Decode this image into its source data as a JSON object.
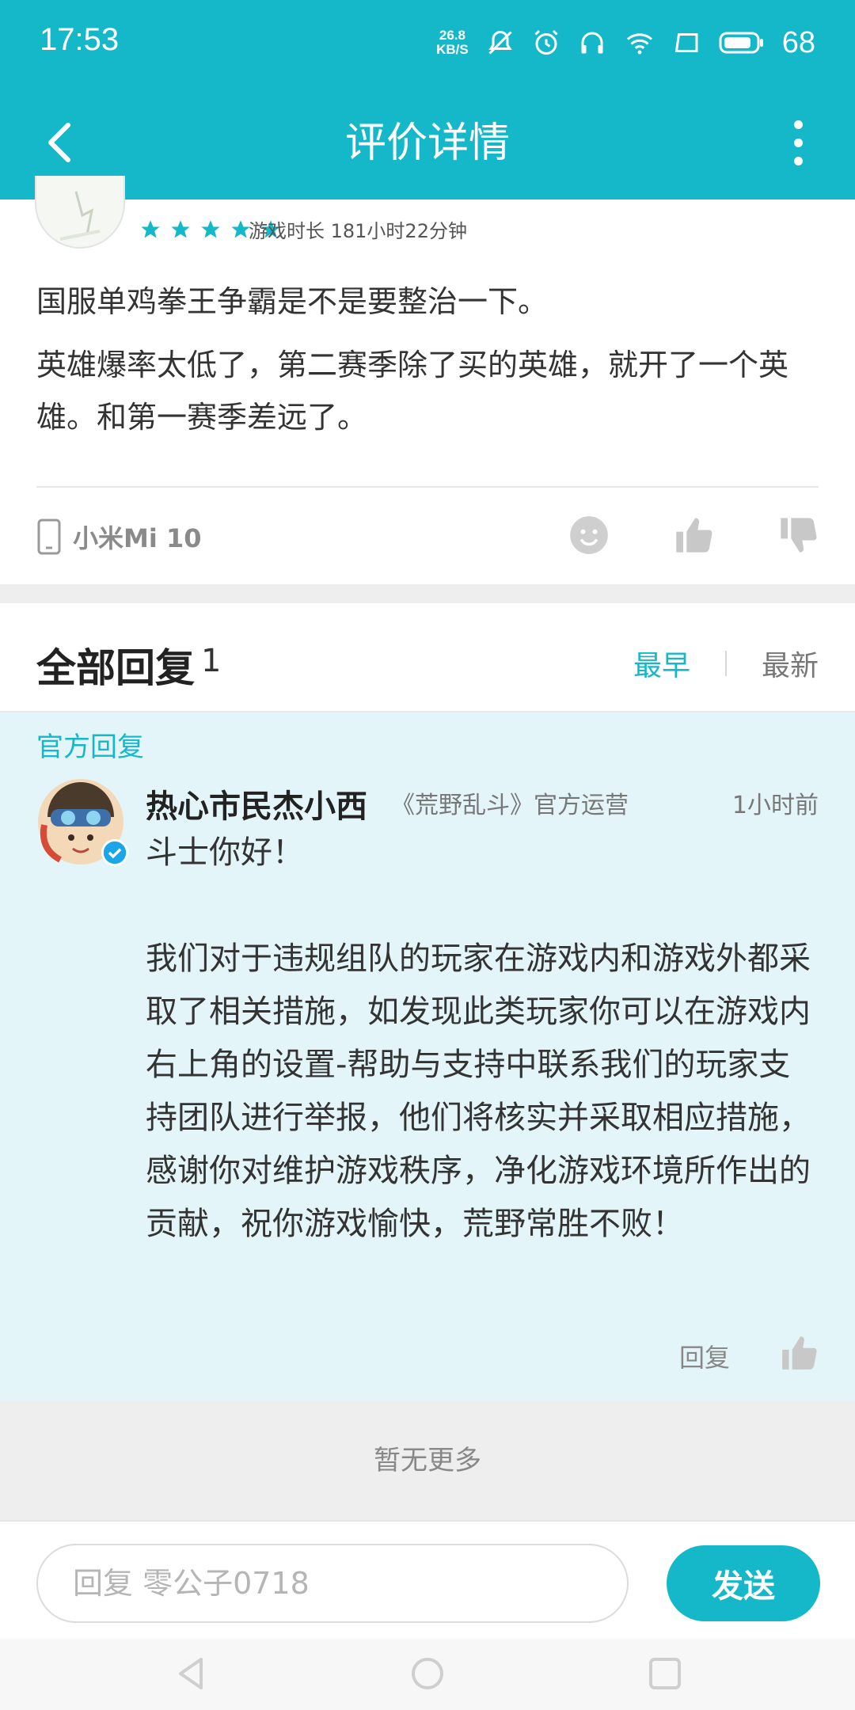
{
  "status_bar": {
    "time": "17:53",
    "net_speed_value": "26.8",
    "net_speed_unit": "KB/S",
    "battery": "68",
    "icons": [
      "mute-icon",
      "alarm-icon",
      "headset-icon",
      "wifi-icon",
      "screen-icon",
      "battery-icon"
    ]
  },
  "app_bar": {
    "title": "评价详情",
    "back_icon": "back-arrow-icon",
    "more_icon": "more-vertical-icon"
  },
  "review": {
    "rating_stars": 5,
    "playtime": "游戏时长 181小时22分钟",
    "paragraphs": [
      "国服单鸡拳王争霸是不是要整治一下。",
      "英雄爆率太低了，第二赛季除了买的英雄，就开了一个英雄。和第一赛季差远了。"
    ],
    "device": "小米Mi 10",
    "colors": {
      "star": "#15b8c8",
      "icon_gray": "#c8c8c8"
    }
  },
  "replies": {
    "label": "全部回复",
    "count": "1",
    "sort_earliest": "最早",
    "sort_latest": "最新"
  },
  "official_reply": {
    "tag": "官方回复",
    "name": "热心市民杰小西",
    "role": "《荒野乱斗》官方运营",
    "time": "1小时前",
    "body": "斗士你好！\n\n我们对于违规组队的玩家在游戏内和游戏外都采取了相关措施，如发现此类玩家你可以在游戏内右上角的设置-帮助与支持中联系我们的玩家支持团队进行举报，他们将核实并采取相应措施，感谢你对维护游戏秩序，净化游戏环境所作出的贡献，祝你游戏愉快，荒野常胜不败！",
    "reply_label": "回复"
  },
  "footer": {
    "no_more": "暂无更多",
    "input_placeholder": "回复 零公子0718",
    "send_label": "发送"
  },
  "accent_color": "#15b8c8"
}
